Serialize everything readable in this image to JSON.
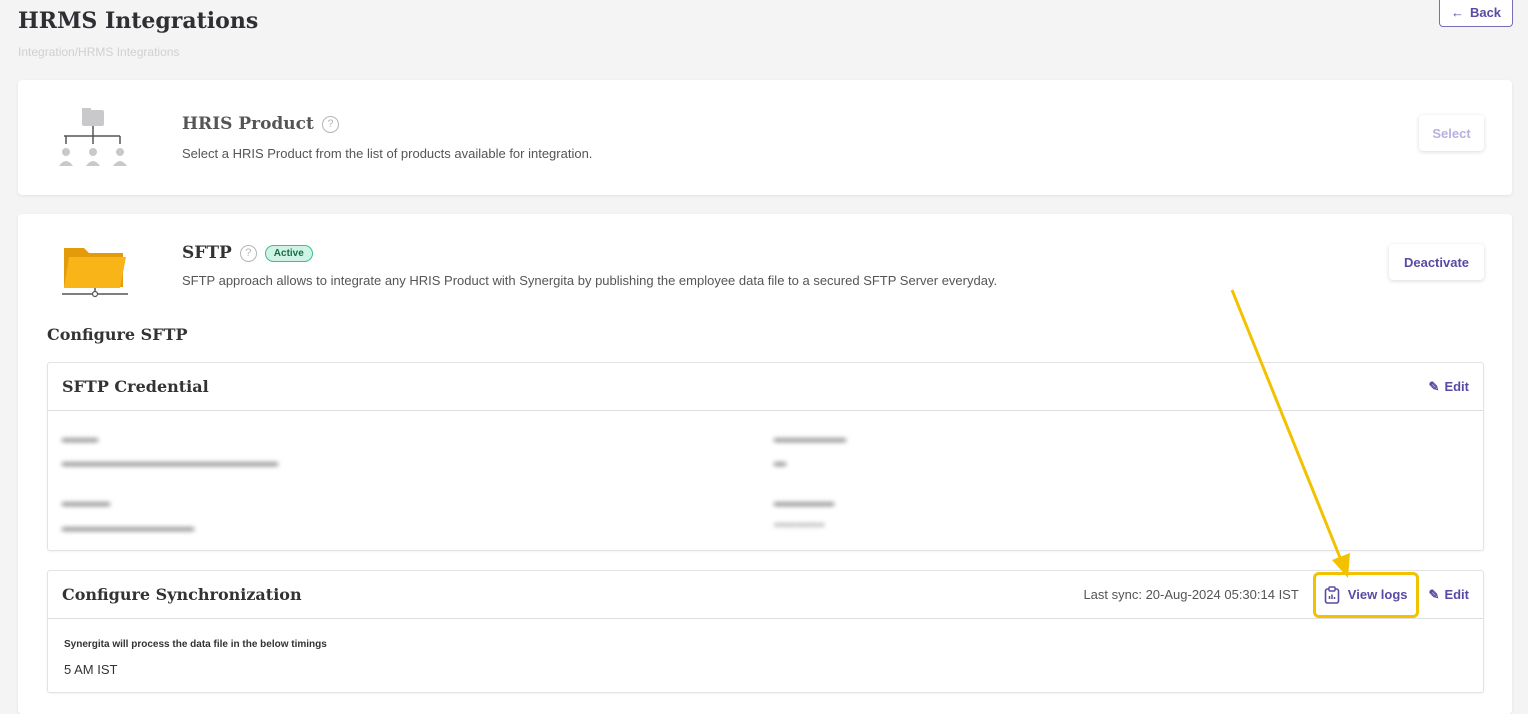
{
  "page": {
    "title": "HRMS Integrations",
    "breadcrumb": "Integration/HRMS Integrations",
    "back_label": "Back"
  },
  "hris": {
    "title": "HRIS Product",
    "description": "Select a HRIS Product from the list of products available for integration.",
    "select_label": "Select"
  },
  "sftp": {
    "title": "SFTP",
    "status": "Active",
    "description": "SFTP approach allows to integrate any HRIS Product with Synergita by publishing the employee data file to a secured SFTP Server everyday.",
    "deactivate_label": "Deactivate",
    "configure_heading": "Configure SFTP"
  },
  "credential": {
    "title": "SFTP Credential",
    "edit_label": "Edit"
  },
  "sync": {
    "title": "Configure Synchronization",
    "last_sync": "Last sync: 20-Aug-2024 05:30:14 IST",
    "view_logs_label": "View logs",
    "edit_label": "Edit",
    "note": "Synergita will process the data file in the below timings",
    "timing": "5 AM IST"
  },
  "colors": {
    "accent": "#5a4aa5",
    "active_badge": "#cff3e4",
    "highlight": "#f2c200",
    "folder": "#f9b418"
  },
  "icons": {
    "back": "arrow-left-icon",
    "help": "question-circle-icon",
    "edit": "pencil-icon",
    "logs": "clipboard-chart-icon",
    "hris": "org-chart-icon",
    "sftp": "folder-network-icon"
  }
}
